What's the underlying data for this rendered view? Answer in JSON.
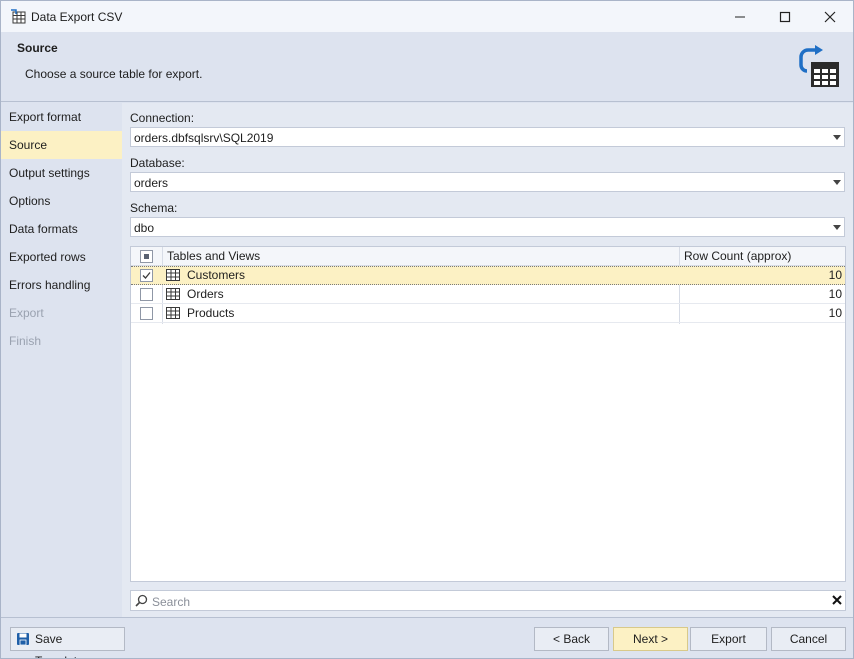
{
  "window": {
    "title": "Data Export CSV"
  },
  "header": {
    "title": "Source",
    "description": "Choose a source table for export."
  },
  "sidebar": {
    "items": [
      {
        "label": "Export format",
        "state": "normal"
      },
      {
        "label": "Source",
        "state": "active"
      },
      {
        "label": "Output settings",
        "state": "normal"
      },
      {
        "label": "Options",
        "state": "normal"
      },
      {
        "label": "Data formats",
        "state": "normal"
      },
      {
        "label": "Exported rows",
        "state": "normal"
      },
      {
        "label": "Errors handling",
        "state": "normal"
      },
      {
        "label": "Export",
        "state": "disabled"
      },
      {
        "label": "Finish",
        "state": "disabled"
      }
    ]
  },
  "form": {
    "connection": {
      "label": "Connection:",
      "value": "orders.dbfsqlsrv\\SQL2019"
    },
    "database": {
      "label": "Database:",
      "value": "orders"
    },
    "schema": {
      "label": "Schema:",
      "value": "dbo"
    }
  },
  "grid": {
    "columns": [
      "Tables and Views",
      "Row Count (approx)"
    ],
    "rows": [
      {
        "name": "Customers",
        "count": "10",
        "checked": true,
        "selected": true
      },
      {
        "name": "Orders",
        "count": "10",
        "checked": false,
        "selected": false
      },
      {
        "name": "Products",
        "count": "10",
        "checked": false,
        "selected": false
      }
    ]
  },
  "search": {
    "placeholder": "Search"
  },
  "footer": {
    "save_template": "Save Template...",
    "back": "< Back",
    "next": "Next >",
    "export": "Export",
    "cancel": "Cancel"
  },
  "colors": {
    "accent": "#fcf1c4",
    "icon_blue": "#1f6fc5",
    "icon_dark": "#2b2b2b"
  }
}
